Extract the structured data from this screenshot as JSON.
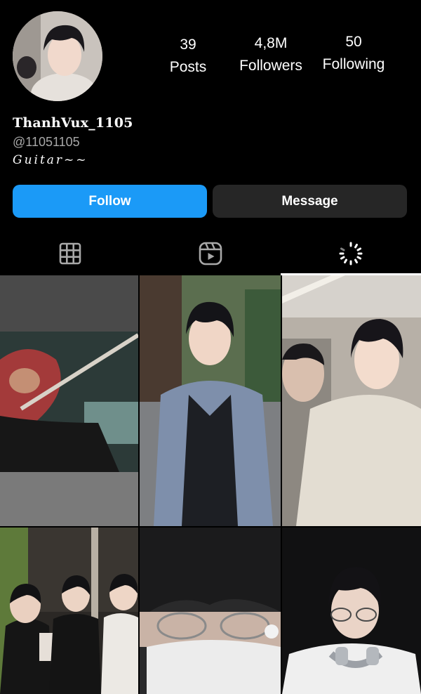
{
  "profile": {
    "username": "ThanhVux_1105",
    "handle": "@11051105",
    "bio": "Guitar~~"
  },
  "stats": [
    {
      "value": "39",
      "label": "Posts"
    },
    {
      "value": "4,8M",
      "label": "Followers"
    },
    {
      "value": "50",
      "label": "Following"
    }
  ],
  "actions": {
    "follow_label": "Follow",
    "message_label": "Message"
  },
  "tabs": [
    {
      "icon": "grid-icon",
      "selected": false
    },
    {
      "icon": "reels-icon",
      "selected": false
    },
    {
      "icon": "tagged-loading-icon",
      "selected": true
    }
  ],
  "colors": {
    "background": "#000000",
    "follow_button": "#1b9af7",
    "message_button": "#262626",
    "secondary_text": "#a8a8a8"
  },
  "posts": [
    {
      "icon": "bass-guitar-photo"
    },
    {
      "icon": "boy-in-jacket-photo"
    },
    {
      "icon": "boy-in-hoodie-photo"
    },
    {
      "icon": "group-photo"
    },
    {
      "icon": "boy-with-glasses-closeup-photo"
    },
    {
      "icon": "boy-with-headphones-photo"
    }
  ]
}
